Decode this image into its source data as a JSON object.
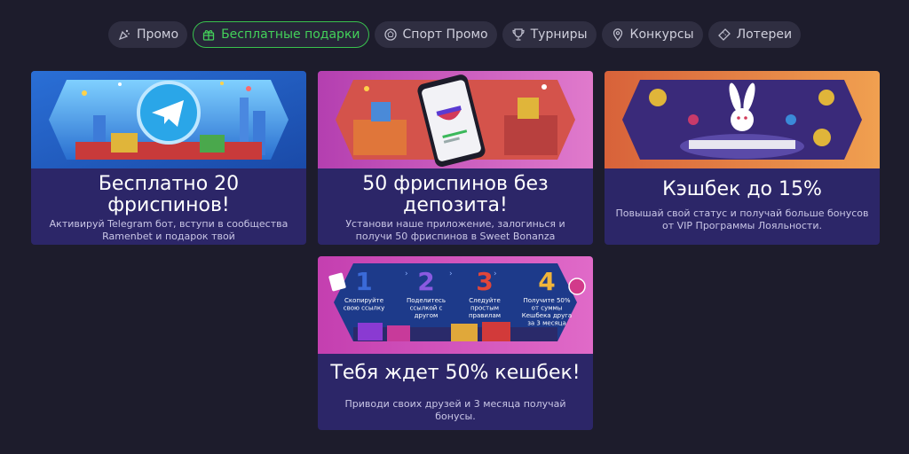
{
  "tabs": [
    {
      "label": "Промо",
      "icon": "confetti-icon",
      "active": false
    },
    {
      "label": "Бесплатные подарки",
      "icon": "gift-icon",
      "active": true
    },
    {
      "label": "Спорт Промо",
      "icon": "ball-icon",
      "active": false
    },
    {
      "label": "Турниры",
      "icon": "trophy-icon",
      "active": false
    },
    {
      "label": "Конкурсы",
      "icon": "pin-icon",
      "active": false
    },
    {
      "label": "Лотереи",
      "icon": "ticket-icon",
      "active": false
    }
  ],
  "cards": [
    {
      "title": "Бесплатно 20 фриспинов!",
      "desc": "Активируй Telegram бот, вступи в сообщества Ramenbet и подарок твой"
    },
    {
      "title": "50 фриспинов без депозита!",
      "desc": "Установи наше приложение, залогинься и получи 50 фриспинов в Sweet Bonanza"
    },
    {
      "title": "Кэшбек до 15%",
      "desc": "Повышай свой статус и получай больше бонусов от VIP Программы Лояльности."
    },
    {
      "title": "Тебя ждет 50% кешбек!",
      "desc": "Приводи своих друзей и 3 месяца получай бонусы."
    }
  ],
  "steps_banner": {
    "steps": [
      {
        "num": "1",
        "text": [
          "Скопируйте",
          "свою ссылку"
        ]
      },
      {
        "num": "2",
        "text": [
          "Поделитесь",
          "ссылкой с",
          "другом"
        ]
      },
      {
        "num": "3",
        "text": [
          "Следуйте",
          "простым",
          "правилам"
        ]
      },
      {
        "num": "4",
        "text": [
          "Получите 50%",
          "от суммы",
          "Кешбека друга",
          "за 3 месяца"
        ]
      }
    ]
  },
  "colors": {
    "background": "#1d1c2c",
    "tab_bg": "#2f2e41",
    "active_tab": "#39c14e",
    "card_bg": "#2c2668"
  }
}
